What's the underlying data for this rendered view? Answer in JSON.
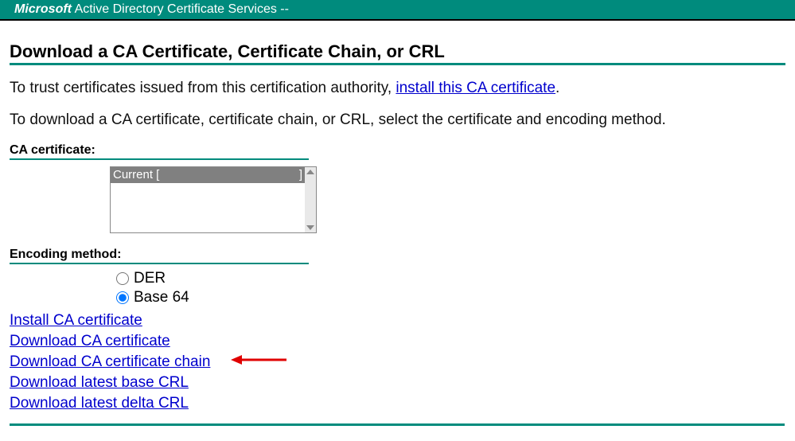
{
  "header": {
    "brand": "Microsoft",
    "service_name": " Active Directory Certificate Services  --"
  },
  "page_title": "Download a CA Certificate, Certificate Chain, or CRL",
  "intro1_prefix": "To trust certificates issued from this certification authority, ",
  "intro1_link": "install this CA certificate",
  "intro1_suffix": ".",
  "intro2": "To download a CA certificate, certificate chain, or CRL, select the certificate and encoding method.",
  "ca_cert_label": "CA certificate:",
  "ca_list_selected_left": "Current [",
  "ca_list_selected_right": "]",
  "encoding_label": "Encoding method:",
  "encoding_options": {
    "der": "DER",
    "base64": "Base 64"
  },
  "links": {
    "install": "Install CA certificate",
    "download_cert": "Download CA certificate",
    "download_chain": "Download CA certificate chain",
    "download_base_crl": "Download latest base CRL",
    "download_delta_crl": "Download latest delta CRL"
  }
}
